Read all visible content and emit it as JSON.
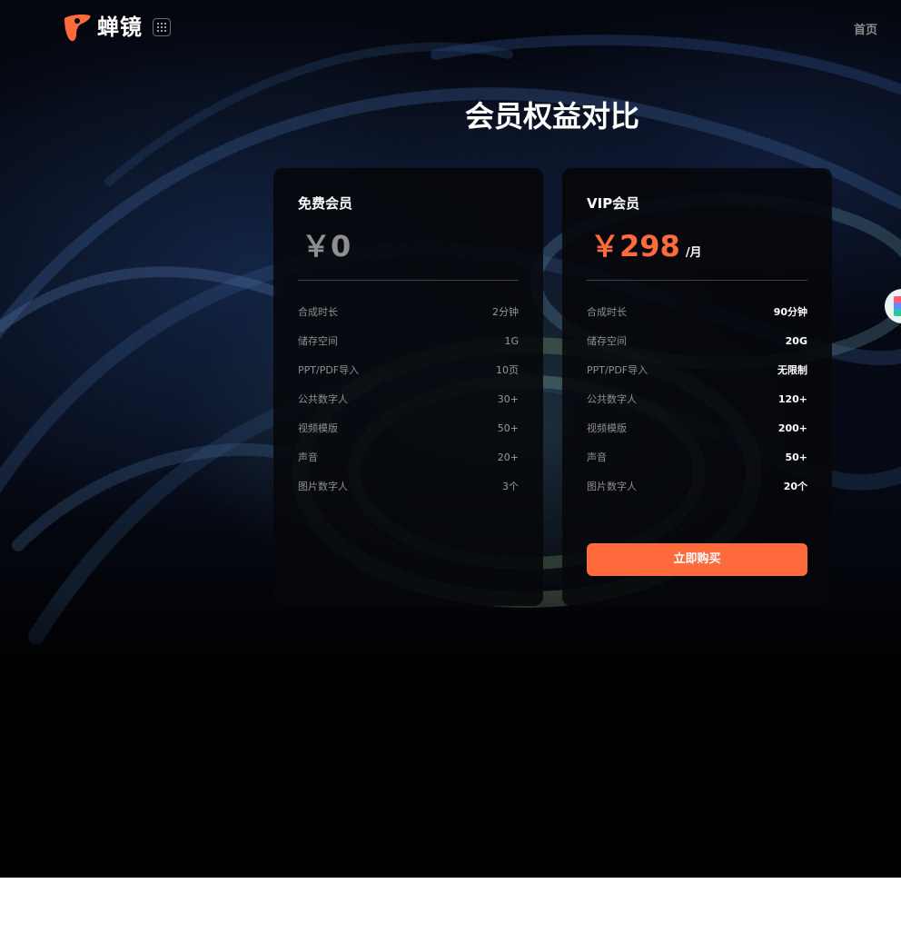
{
  "header": {
    "logo_text": "蝉镜",
    "logo_icon": "chanjing-logo-icon",
    "apps_icon": "apps-grid-icon",
    "nav_home": "首页"
  },
  "page": {
    "title": "会员权益对比"
  },
  "plans": {
    "free": {
      "name": "免费会员",
      "price": "￥0",
      "features": [
        {
          "label": "合成时长",
          "value": "2分钟"
        },
        {
          "label": "储存空间",
          "value": "1G"
        },
        {
          "label": "PPT/PDF导入",
          "value": "10页"
        },
        {
          "label": "公共数字人",
          "value": "30+"
        },
        {
          "label": "视频模版",
          "value": "50+"
        },
        {
          "label": "声音",
          "value": "20+"
        },
        {
          "label": "图片数字人",
          "value": "3个"
        }
      ]
    },
    "vip": {
      "name": "VIP会员",
      "price": "￥298",
      "unit": "/月",
      "features": [
        {
          "label": "合成时长",
          "value": "90分钟"
        },
        {
          "label": "储存空间",
          "value": "20G"
        },
        {
          "label": "PPT/PDF导入",
          "value": "无限制"
        },
        {
          "label": "公共数字人",
          "value": "120+"
        },
        {
          "label": "视频模版",
          "value": "200+"
        },
        {
          "label": "声音",
          "value": "50+"
        },
        {
          "label": "图片数字人",
          "value": "20个"
        }
      ],
      "buy_label": "立即购买"
    }
  },
  "colors": {
    "accent": "#ff6b3d",
    "background": "#000000",
    "card": "#06070a"
  }
}
